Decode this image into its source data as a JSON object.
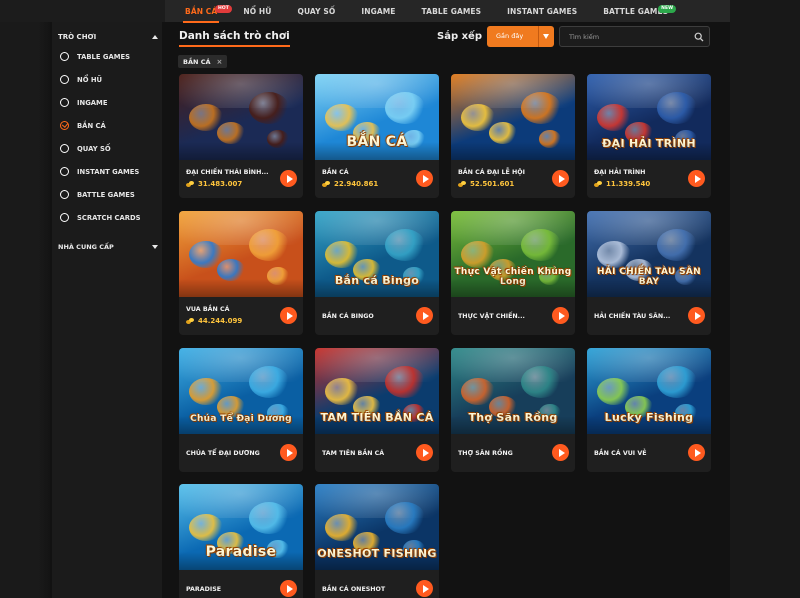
{
  "nav": {
    "items": [
      {
        "label": "BẮN CÁ",
        "active": true,
        "badge": "HOT"
      },
      {
        "label": "NỔ HŨ"
      },
      {
        "label": "QUAY SỐ"
      },
      {
        "label": "INGAME"
      },
      {
        "label": "TABLE GAMES"
      },
      {
        "label": "INSTANT GAMES"
      },
      {
        "label": "BATTLE GAMES",
        "badge": "NEW"
      }
    ]
  },
  "sidebar": {
    "section_title": "TRÒ CHƠI",
    "items": [
      {
        "label": "TABLE GAMES",
        "checked": false
      },
      {
        "label": "NỔ HŨ",
        "checked": false
      },
      {
        "label": "inGame",
        "checked": false
      },
      {
        "label": "BẮN CÁ",
        "checked": true
      },
      {
        "label": "QUAY SỐ",
        "checked": false
      },
      {
        "label": "INSTANT GAMES",
        "checked": false
      },
      {
        "label": "BATTLE GAMES",
        "checked": false
      },
      {
        "label": "SCRATCH CARDS",
        "checked": false
      }
    ],
    "provider_title": "NHÀ CUNG CẤP"
  },
  "main": {
    "title": "Danh sách trò chơi",
    "sort_label": "Sắp xếp",
    "sort_value": "Gần đây",
    "search_placeholder": "Tìm kiếm",
    "filter_chip": "BẮN CÁ",
    "filter_chip_close": "×"
  },
  "games": [
    {
      "name": "ĐẠI CHIẾN THÁI BÌNH...",
      "jackpot": "31.483.007",
      "colors": [
        "#1b2a55",
        "#4a1d16",
        "#c9761f"
      ]
    },
    {
      "name": "BẮN CÁ",
      "jackpot": "22.940.861",
      "colors": [
        "#1e87d6",
        "#7fd3f5",
        "#f2c44a"
      ],
      "logo": "BẮN CÁ"
    },
    {
      "name": "BẮN CÁ ĐẠI LỄ HỘI",
      "jackpot": "52.501.601",
      "colors": [
        "#0c3b7a",
        "#e07a1a",
        "#f5c83c"
      ]
    },
    {
      "name": "ĐẠI HẢI TRÌNH",
      "jackpot": "11.339.540",
      "colors": [
        "#122a5c",
        "#2e5fae",
        "#d6372e"
      ],
      "logo": "ĐẠI HẢI TRÌNH"
    },
    {
      "name": "VUA BẮN CÁ",
      "jackpot": "44.244.099",
      "colors": [
        "#c8501b",
        "#f2a43a",
        "#2b7bd1"
      ]
    },
    {
      "name": "BẮN CÁ BINGO",
      "colors": [
        "#0e5a8a",
        "#35a5c8",
        "#e8c12e"
      ],
      "logo": "Bắn cá Bingo"
    },
    {
      "name": "THỰC VẬT CHIẾN...",
      "colors": [
        "#2a6a2a",
        "#7bbf3a",
        "#d9a02b"
      ],
      "logo": "Thực Vật chiến Khủng Long"
    },
    {
      "name": "HẢI CHIẾN TÀU SÂN...",
      "colors": [
        "#14335f",
        "#4673b3",
        "#b7c7e0"
      ],
      "logo": "HẢI CHIẾN TÀU SÂN BAY"
    },
    {
      "name": "CHÚA TỂ ĐẠI DƯƠNG",
      "colors": [
        "#0a5fa3",
        "#3fb0e6",
        "#e8a02b"
      ],
      "logo": "Chúa Tể Đại Dương"
    },
    {
      "name": "TAM TIÊN BẮN CÁ",
      "colors": [
        "#0b3c6e",
        "#c7302a",
        "#f2c441"
      ],
      "logo": "TAM TIÊN BẮN CÁ"
    },
    {
      "name": "THỢ SĂN RỒNG",
      "colors": [
        "#173e5a",
        "#2f8a8a",
        "#d5642a"
      ],
      "logo": "Thợ Săn Rồng"
    },
    {
      "name": "BẮN CÁ VUI VẺ",
      "colors": [
        "#0a3f7e",
        "#2fa3d8",
        "#8fd14f"
      ],
      "logo": "Lucky Fishing"
    },
    {
      "name": "PARADISE",
      "colors": [
        "#0b69b3",
        "#58c1ec",
        "#f2c43a"
      ],
      "logo": "Paradise"
    },
    {
      "name": "BẮN CÁ ONESHOT",
      "colors": [
        "#0b3566",
        "#2a7fc6",
        "#f2b62a"
      ],
      "logo": "ONESHOT FISHING"
    }
  ],
  "accent": "#ff6a1a"
}
